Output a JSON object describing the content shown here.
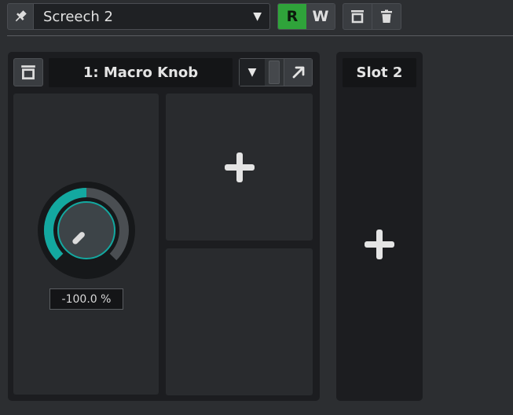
{
  "toolbar": {
    "pin_icon": "pin-icon",
    "preset_name": "Screech 2",
    "preset_dropdown_icon": "chevron-down-icon",
    "read_label": "R",
    "write_label": "W",
    "show_editor_icon": "slot-icon",
    "delete_icon": "trash-icon"
  },
  "slot1": {
    "title": "1: Macro Knob",
    "knob_value": "-100.0 %",
    "knob_position": 0.0,
    "colors": {
      "arc": "#13a8a0",
      "knob_face": "#3d4448"
    },
    "expand_icon": "arrow-up-right-icon",
    "dropdown_icon": "chevron-down-icon",
    "add_icon": "plus-icon"
  },
  "slot2": {
    "title": "Slot 2",
    "add_icon": "plus-icon"
  },
  "colors": {
    "accent_green": "#2fa33a",
    "background": "#2c2e31",
    "panel": "#1c1d20"
  }
}
